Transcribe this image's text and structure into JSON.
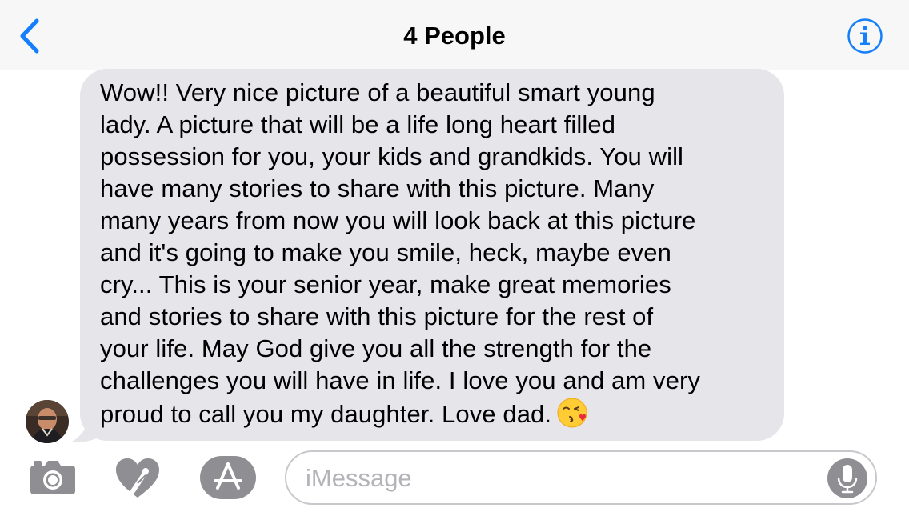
{
  "nav": {
    "title": "4 People"
  },
  "message": {
    "lines": [
      "Wow!! Very nice picture of a beautiful smart young",
      "lady. A picture that will be a life long heart filled",
      "possession for you, your kids and grandkids. You will",
      "have many stories to share with this picture. Many",
      "many years from now you will look back at this picture",
      "and it's going to make you smile, heck, maybe even",
      "cry... This is your senior year, make great memories",
      "and stories to share with this picture for the rest of",
      "your life. May God give you all the strength for the",
      "challenges you will have in life. I love you and am very",
      "proud to call you my daughter. Love dad."
    ],
    "emoji": "kissing-face-with-heart-emoji"
  },
  "composer": {
    "placeholder": "iMessage"
  },
  "icons": {
    "back": "chevron-left-icon",
    "info": "info-icon",
    "camera": "camera-icon",
    "digital_touch": "heart-touch-icon",
    "app_store": "app-store-icon",
    "mic": "microphone-icon"
  },
  "colors": {
    "accent": "#147efb",
    "bubble": "#e5e5ea",
    "toolbar_icon": "#8e8e93",
    "navbar_bg": "#f7f7f7"
  }
}
